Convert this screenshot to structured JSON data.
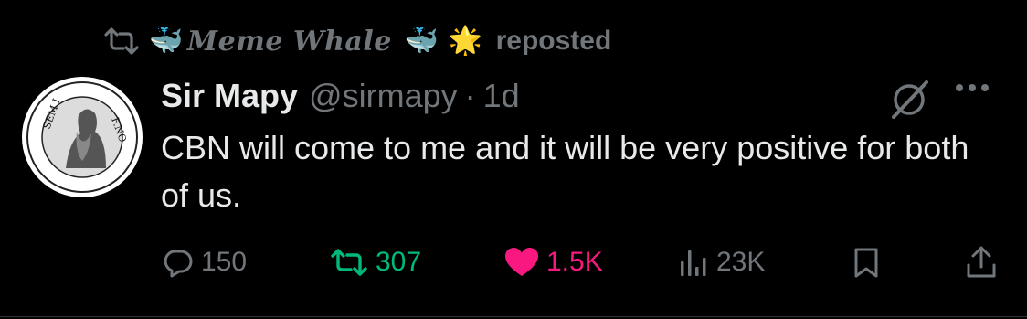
{
  "repost": {
    "reposter_name": "Meme Whale",
    "emoji_before": "🐳",
    "emoji_after_1": "🐳",
    "emoji_after_2": "🌟",
    "label": "reposted"
  },
  "author": {
    "display_name": "Sir Mapy",
    "handle": "@sirmapy",
    "separator": "·",
    "time": "1d"
  },
  "tweet": {
    "text": "CBN will come to me and it will be very positive for both of us."
  },
  "metrics": {
    "replies": "150",
    "reposts": "307",
    "likes": "1.5K",
    "views": "23K"
  },
  "icons": {
    "repost": "repost-icon",
    "reply": "reply-icon",
    "like": "heart-icon",
    "views": "views-icon",
    "bookmark": "bookmark-icon",
    "share": "share-icon",
    "grok": "grok-icon",
    "more": "more-icon"
  },
  "colors": {
    "background": "#000000",
    "primary_text": "#e7e9ea",
    "secondary_text": "#71767b",
    "repost_active": "#00ba7c",
    "like_active": "#f91880"
  }
}
